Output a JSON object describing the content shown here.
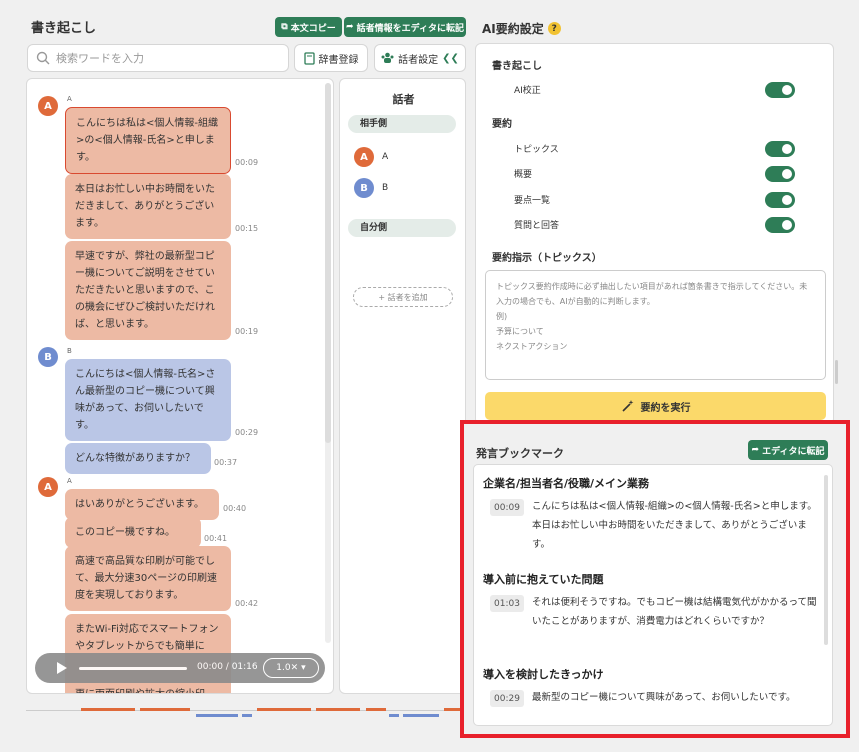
{
  "left": {
    "title": "書き起こし",
    "copy_text_label": "本文コピー",
    "transfer_speaker_label": "話者情報をエディタに転記",
    "search_placeholder": "検索ワードを入力",
    "dictionary_label": "辞書登録",
    "speaker_settings_label": "話者設定"
  },
  "messages": [
    {
      "speaker": "A",
      "text": "こんにちは私は<個人情報-組織>の<個人情報-氏名>と申します。",
      "time": "00:09"
    },
    {
      "speaker": "A",
      "text": "本日はお忙しい中お時間をいただきまして、ありがとうございます。",
      "time": "00:15"
    },
    {
      "speaker": "A",
      "text": "早速ですが、弊社の最新型コピー機についてご説明をさせていただきたいと思いますので、この機会にぜひご検討いただければ、と思います。",
      "time": "00:19"
    },
    {
      "speaker": "B",
      "text": "こんにちは<個人情報-氏名>さん最新型のコピー機について興味があって、お伺いしたいです。",
      "time": "00:29"
    },
    {
      "speaker": "B",
      "text": "どんな特徴がありますか？",
      "time": "00:37"
    },
    {
      "speaker": "A",
      "text": "はいありがとうございます。",
      "time": "00:40"
    },
    {
      "speaker": "A",
      "text": "このコピー機ですね。",
      "time": "00:41"
    },
    {
      "speaker": "A",
      "text": "高速で高品質な印刷が可能でして、最大分速30ページの印刷速度を実現しております。",
      "time": "00:42"
    },
    {
      "speaker": "A",
      "text": "またWi-Fi対応でスマートフォンやタブレットからでも簡単に",
      "time": ""
    },
    {
      "speaker": "A",
      "text": "更に両面印刷や拡大の縮小印",
      "time": ""
    }
  ],
  "player": {
    "time": "00:00 / 01:16",
    "speed": "1.0✕",
    "progress": 0.0
  },
  "speakers_panel": {
    "title": "話者",
    "partner_group": "相手側",
    "self_group": "自分側",
    "speakers": [
      {
        "initial": "A",
        "name": "A"
      },
      {
        "initial": "B",
        "name": "B"
      }
    ],
    "add_label": "+ 話者を追加"
  },
  "right": {
    "title": "AI要約設定",
    "help": "?",
    "transcription_section": "書き起こし",
    "ai_proofread_label": "AI校正",
    "summary_section": "要約",
    "options": [
      {
        "label": "トピックス",
        "on": true
      },
      {
        "label": "概要",
        "on": true
      },
      {
        "label": "要点一覧",
        "on": true
      },
      {
        "label": "質問と回答",
        "on": true
      }
    ],
    "instruction_title": "要約指示（トピックス）",
    "instruction_placeholder_1": "トピックス要約作成時に必ず抽出したい項目があれば箇条書きで指示してください。未入力の場合でも、AIが自動的に判断します。",
    "instruction_placeholder_2": "例)",
    "instruction_placeholder_3": "予算について",
    "instruction_placeholder_4": "ネクストアクション",
    "run_label": "要約を実行"
  },
  "bookmark": {
    "title": "発言ブックマーク",
    "transfer_label": "エディタに転記",
    "items": [
      {
        "heading": "企業名/担当者名/役職/メイン業務",
        "time": "00:09",
        "text": "こんにちは私は<個人情報-組織>の<個人情報-氏名>と申します。本日はお忙しい中お時間をいただきまして、ありがとうございます。"
      },
      {
        "heading": "導入前に抱えていた問題",
        "time": "01:03",
        "text": "それは便利そうですね。でもコピー機は結構電気代がかかるって聞いたことがありますが、消費電力はどれくらいですか？"
      },
      {
        "heading": "導入を検討したきっかけ",
        "time": "00:29",
        "text": "最新型のコピー機について興味があって、お伺いしたいです。"
      }
    ]
  }
}
